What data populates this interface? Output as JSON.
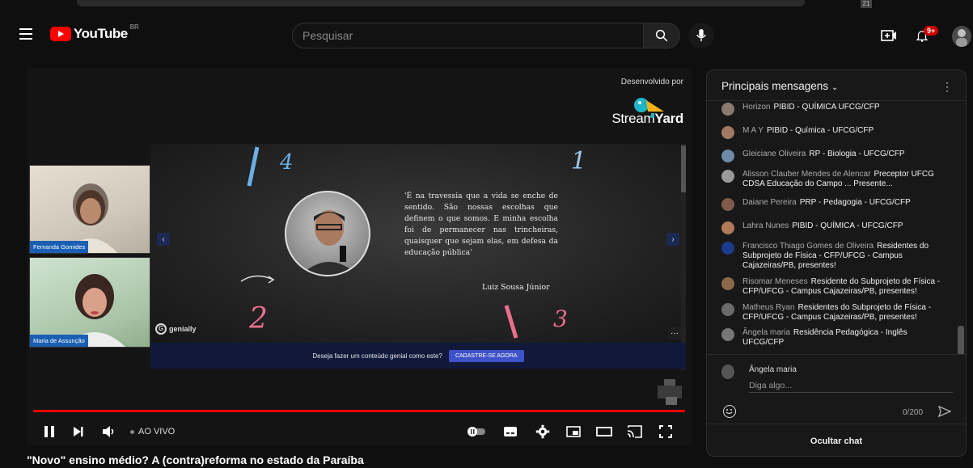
{
  "masthead": {
    "logo_text": "YouTube",
    "country_code": "BR",
    "search_placeholder": "Pesquisar",
    "notification_count": "9+"
  },
  "top_strip": {
    "mini_label": "21"
  },
  "player": {
    "watermark_dev": "Desenvolvido por",
    "watermark_brand_a": "Stream",
    "watermark_brand_b": "Yard",
    "camera_labels": [
      "Fernanda Gomides",
      "Maria de Assunção"
    ],
    "slide": {
      "quote": "'É na travessia que a vida se enche de sentido. São nossas escolhas que definem o que somos. E minha escolha foi de permanecer nas trincheiras, quaisquer que sejam elas, em defesa da educação pública'",
      "author": "Luiz Sousa Júnior",
      "numbers": [
        "4",
        "1",
        "2",
        "3"
      ],
      "genially_label": "genially"
    },
    "cta": {
      "text": "Deseja fazer um conteúdo genial como este?",
      "button": "CADASTRE-SE AGORA"
    },
    "live_label": "AO VIVO",
    "progress_fraction": 1.0
  },
  "video_title": "\"Novo\" ensino médio? A (contra)reforma no estado da Paraíba",
  "chat": {
    "header": "Principais mensagens",
    "messages": [
      {
        "author": "Horizon",
        "text": "PIBID - QUÍMICA UFCG/CFP",
        "avatar_color": "#8b7a6e"
      },
      {
        "author": "M A Y",
        "text": "PIBID - Química - UFCG/CFP",
        "avatar_color": "#a07a62"
      },
      {
        "author": "Gleiciane Oliveira",
        "text": "RP - Biologia - UFCG/CFP",
        "avatar_color": "#6e8aa8"
      },
      {
        "author": "Alisson Clauber Mendes de Alencar",
        "text": "Preceptor UFCG CDSA Educação do Campo ... Presente...",
        "avatar_color": "#9a9a9a"
      },
      {
        "author": "Daiane Pereira",
        "text": "PRP - Pedagogia - UFCG/CFP",
        "avatar_color": "#7d5a4a"
      },
      {
        "author": "Lahra Nunes",
        "text": "PIBID - QUÍMICA - UFCG/CFP",
        "avatar_color": "#b07a5a"
      },
      {
        "author": "Francisco Thiago Gomes de Oliveira",
        "text": "Residentes do Subprojeto de Física - CFP/UFCG - Campus Cajazeiras/PB, presentes!",
        "avatar_color": "#1d3c8c"
      },
      {
        "author": "Risomar Meneses",
        "text": "Residente do Subprojeto de Física - CFP/UFCG - Campus Cajazeiras/PB, presentes!",
        "avatar_color": "#8a6a4a"
      },
      {
        "author": "Matheus Ryan",
        "text": "Residentes do Subprojeto de Física - CFP/UFCG - Campus Cajazeiras/PB, presentes!",
        "avatar_color": "#6a6a6a"
      },
      {
        "author": "Ângela maria",
        "text": "Residência Pedagógica - Inglês UFCG/CFP",
        "avatar_color": "#777777"
      }
    ],
    "composer": {
      "name": "Ângela maria",
      "placeholder": "Diga algo...",
      "counter": "0/200"
    },
    "hide_button": "Ocultar chat"
  }
}
